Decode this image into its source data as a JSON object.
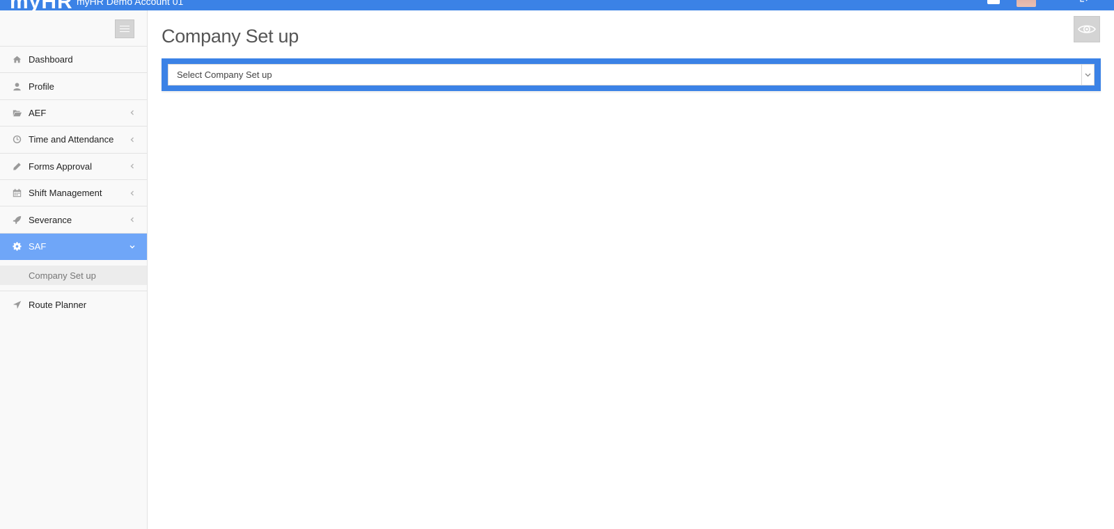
{
  "header": {
    "brand": "myHR",
    "account": "myHR Demo Account 01"
  },
  "sidebar": {
    "toggle_icon": "hamburger-icon",
    "items": [
      {
        "label": "Dashboard",
        "icon": "home-icon",
        "has_chevron": false
      },
      {
        "label": "Profile",
        "icon": "user-icon",
        "has_chevron": false
      },
      {
        "label": "AEF",
        "icon": "folder-open-icon",
        "has_chevron": true
      },
      {
        "label": "Time and Attendance",
        "icon": "clock-icon",
        "has_chevron": true
      },
      {
        "label": "Forms Approval",
        "icon": "pencil-icon",
        "has_chevron": true
      },
      {
        "label": "Shift Management",
        "icon": "calendar-icon",
        "has_chevron": true
      },
      {
        "label": "Severance",
        "icon": "rocket-icon",
        "has_chevron": true
      },
      {
        "label": "SAF",
        "icon": "gear-icon",
        "has_chevron": true,
        "active": true
      },
      {
        "label": "Route Planner",
        "icon": "location-arrow-icon",
        "has_chevron": false
      }
    ],
    "subitems": [
      {
        "label": "Company Set up"
      }
    ]
  },
  "main": {
    "title": "Company Set up",
    "select": {
      "value": "Select Company Set up"
    },
    "eye_icon": "eye-icon"
  },
  "colors": {
    "topbar": "#3b82e6",
    "active_item": "#6fa6f8",
    "panel": "#3b82e6"
  }
}
